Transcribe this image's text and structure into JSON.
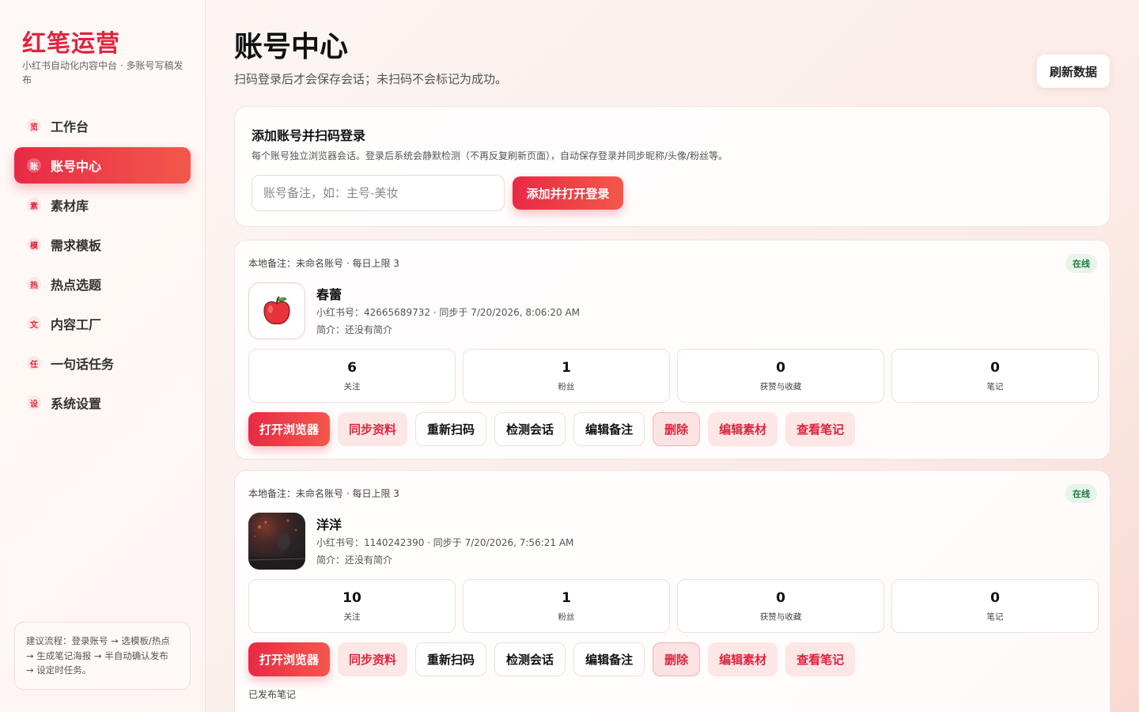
{
  "brand": {
    "title": "红笔运营",
    "subtitle": "小红书自动化内容中台 · 多账号写稿发布"
  },
  "nav": [
    {
      "badge": "览",
      "label": "工作台",
      "active": false
    },
    {
      "badge": "账",
      "label": "账号中心",
      "active": true
    },
    {
      "badge": "素",
      "label": "素材库",
      "active": false
    },
    {
      "badge": "模",
      "label": "需求模板",
      "active": false
    },
    {
      "badge": "热",
      "label": "热点选题",
      "active": false
    },
    {
      "badge": "文",
      "label": "内容工厂",
      "active": false
    },
    {
      "badge": "任",
      "label": "一句话任务",
      "active": false
    },
    {
      "badge": "设",
      "label": "系统设置",
      "active": false
    }
  ],
  "tip": "建议流程：登录账号 → 选模板/热点 → 生成笔记海报 → 半自动确认发布 → 设定时任务。",
  "header": {
    "title": "账号中心",
    "subtitle": "扫码登录后才会保存会话；未扫码不会标记为成功。",
    "refresh_label": "刷新数据"
  },
  "add": {
    "title": "添加账号并扫码登录",
    "desc": "每个账号独立浏览器会话。登录后系统会静默检测（不再反复刷新页面），自动保存登录并同步昵称/头像/粉丝等。",
    "placeholder": "账号备注，如：主号-美妆",
    "button_label": "添加并打开登录"
  },
  "accounts": [
    {
      "note": "本地备注：未命名账号 · 每日上限 3",
      "status": "在线",
      "avatar_icon": "apple-icon",
      "name": "春蕾",
      "meta": "小红书号：42665689732 · 同步于 7/20/2026, 8:06:20 AM",
      "bio": "简介：还没有简介",
      "stats": [
        {
          "value": "6",
          "label": "关注"
        },
        {
          "value": "1",
          "label": "粉丝"
        },
        {
          "value": "0",
          "label": "获赞与收藏"
        },
        {
          "value": "0",
          "label": "笔记"
        }
      ]
    },
    {
      "note": "本地备注：未命名账号 · 每日上限 3",
      "status": "在线",
      "avatar_icon": "photo-avatar",
      "name": "洋洋",
      "meta": "小红书号：1140242390 · 同步于 7/20/2026, 7:56:21 AM",
      "bio": "简介：还没有简介",
      "stats": [
        {
          "value": "10",
          "label": "关注"
        },
        {
          "value": "1",
          "label": "粉丝"
        },
        {
          "value": "0",
          "label": "获赞与收藏"
        },
        {
          "value": "0",
          "label": "笔记"
        }
      ],
      "published_label": "已发布笔记"
    }
  ],
  "actions": {
    "open_browser": "打开浏览器",
    "sync": "同步资料",
    "rescan": "重新扫码",
    "check": "检测会话",
    "edit_note": "编辑备注",
    "delete": "删除",
    "edit_material": "编辑素材",
    "view_notes": "查看笔记"
  },
  "colors": {
    "accent": "#e0243d",
    "online": "#1f7a3e"
  }
}
